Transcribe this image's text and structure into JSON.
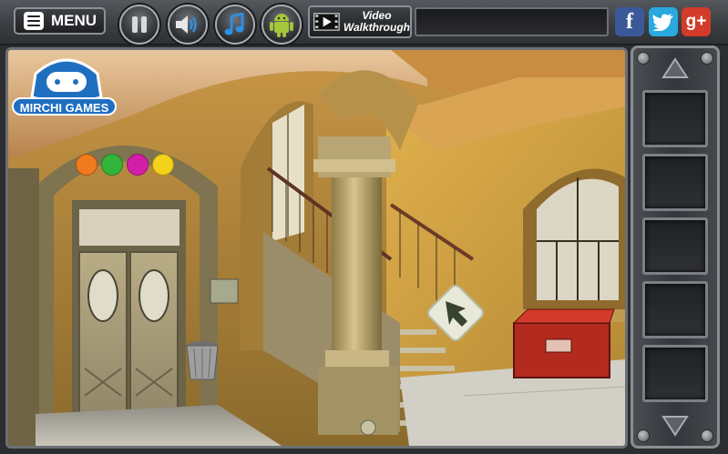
{
  "topbar": {
    "menu_label": "MENU",
    "video_line1": "Video",
    "video_line2": "Walkthrough",
    "message": ""
  },
  "social": {
    "facebook": "f",
    "google": "g+"
  },
  "logo": {
    "text": "MIRCHI GAMES"
  },
  "clue_dots": [
    "#f07a1e",
    "#33b53a",
    "#d31fa8",
    "#f4d21c"
  ],
  "inventory": {
    "slot_count": 5
  },
  "colors": {
    "brand_blue": "#1f6fc0",
    "facebook": "#3b5998",
    "twitter": "#2aa9e0",
    "google": "#d23b2a",
    "android": "#a4c639"
  }
}
